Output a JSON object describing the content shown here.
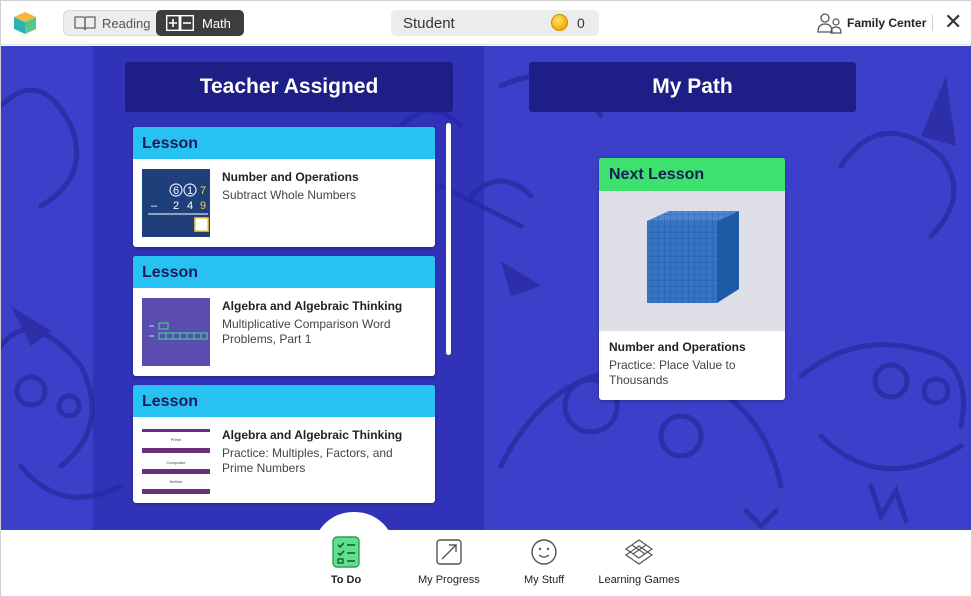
{
  "topbar": {
    "logo_icon": "cube-logo-icon",
    "subjects": [
      {
        "label": "Reading",
        "icon": "book-icon",
        "selected": false
      },
      {
        "label": "Math",
        "icon": "plus-minus-icon",
        "selected": true
      }
    ],
    "student_name": "Student",
    "coin_count": "0",
    "family_center": "Family Center"
  },
  "left_column": {
    "header": "Teacher Assigned",
    "lessons": [
      {
        "tag": "Lesson",
        "title": "Number and Operations",
        "subtitle": "Subtract Whole Numbers"
      },
      {
        "tag": "Lesson",
        "title": "Algebra and Algebraic Thinking",
        "subtitle": "Multiplicative Comparison Word Problems, Part 1"
      },
      {
        "tag": "Lesson",
        "title": "Algebra and Algebraic Thinking",
        "subtitle": "Practice: Multiples, Factors, and Prime Numbers"
      }
    ],
    "thumb1": {
      "d1": "6",
      "d2": "1",
      "d3": "7",
      "sign": "–",
      "e1": "2",
      "e2": "4",
      "e3": "9"
    },
    "thumb3": {
      "l1": "Prime",
      "l2": "Composite",
      "l3": "Neither"
    }
  },
  "right_column": {
    "header": "My Path",
    "next": {
      "tag": "Next Lesson",
      "title": "Number and Operations",
      "subtitle": "Practice: Place Value to Thousands"
    }
  },
  "bottom_nav": [
    {
      "label": "To Do",
      "icon": "checklist-icon",
      "active": true
    },
    {
      "label": "My Progress",
      "icon": "progress-arrow-icon",
      "active": false
    },
    {
      "label": "My Stuff",
      "icon": "smiley-icon",
      "active": false
    },
    {
      "label": "Learning Games",
      "icon": "games-icon",
      "active": false
    }
  ],
  "colors": {
    "background": "#3c3fc9",
    "header_bg": "#1d1f86",
    "lesson_tag": "#27c2f2",
    "next_tag": "#3de26e",
    "tag_text": "#1b1b59"
  }
}
